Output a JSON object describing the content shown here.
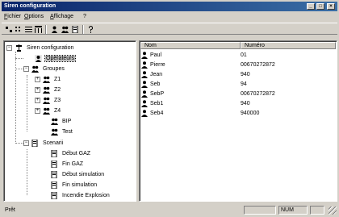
{
  "window": {
    "title": "Siren configuration"
  },
  "menu": {
    "items": [
      "Fichier",
      "Options",
      "Affichage",
      "?"
    ]
  },
  "tree": {
    "root": "Siren configuration",
    "operators": "Opérateurs",
    "groups_label": "Groupes",
    "groups": [
      "Z1",
      "Z2",
      "Z3",
      "Z4",
      "BIP",
      "Test"
    ],
    "scenarios_label": "Scenarii",
    "scenarios": [
      "Début GAZ",
      "Fin GAZ",
      "Début simulation",
      "Fin simulation",
      "Incendie Explosion"
    ]
  },
  "list": {
    "columns": [
      "Nom",
      "Numéro"
    ],
    "rows": [
      {
        "name": "Paul",
        "number": "01"
      },
      {
        "name": "Pierre",
        "number": "00670272872"
      },
      {
        "name": "Jean",
        "number": "940"
      },
      {
        "name": "Seb",
        "number": "94"
      },
      {
        "name": "SebP",
        "number": "00670272872"
      },
      {
        "name": "Seb1",
        "number": "940"
      },
      {
        "name": "Seb4",
        "number": "940000"
      }
    ]
  },
  "status": {
    "text": "Prêt",
    "num": "NUM"
  }
}
